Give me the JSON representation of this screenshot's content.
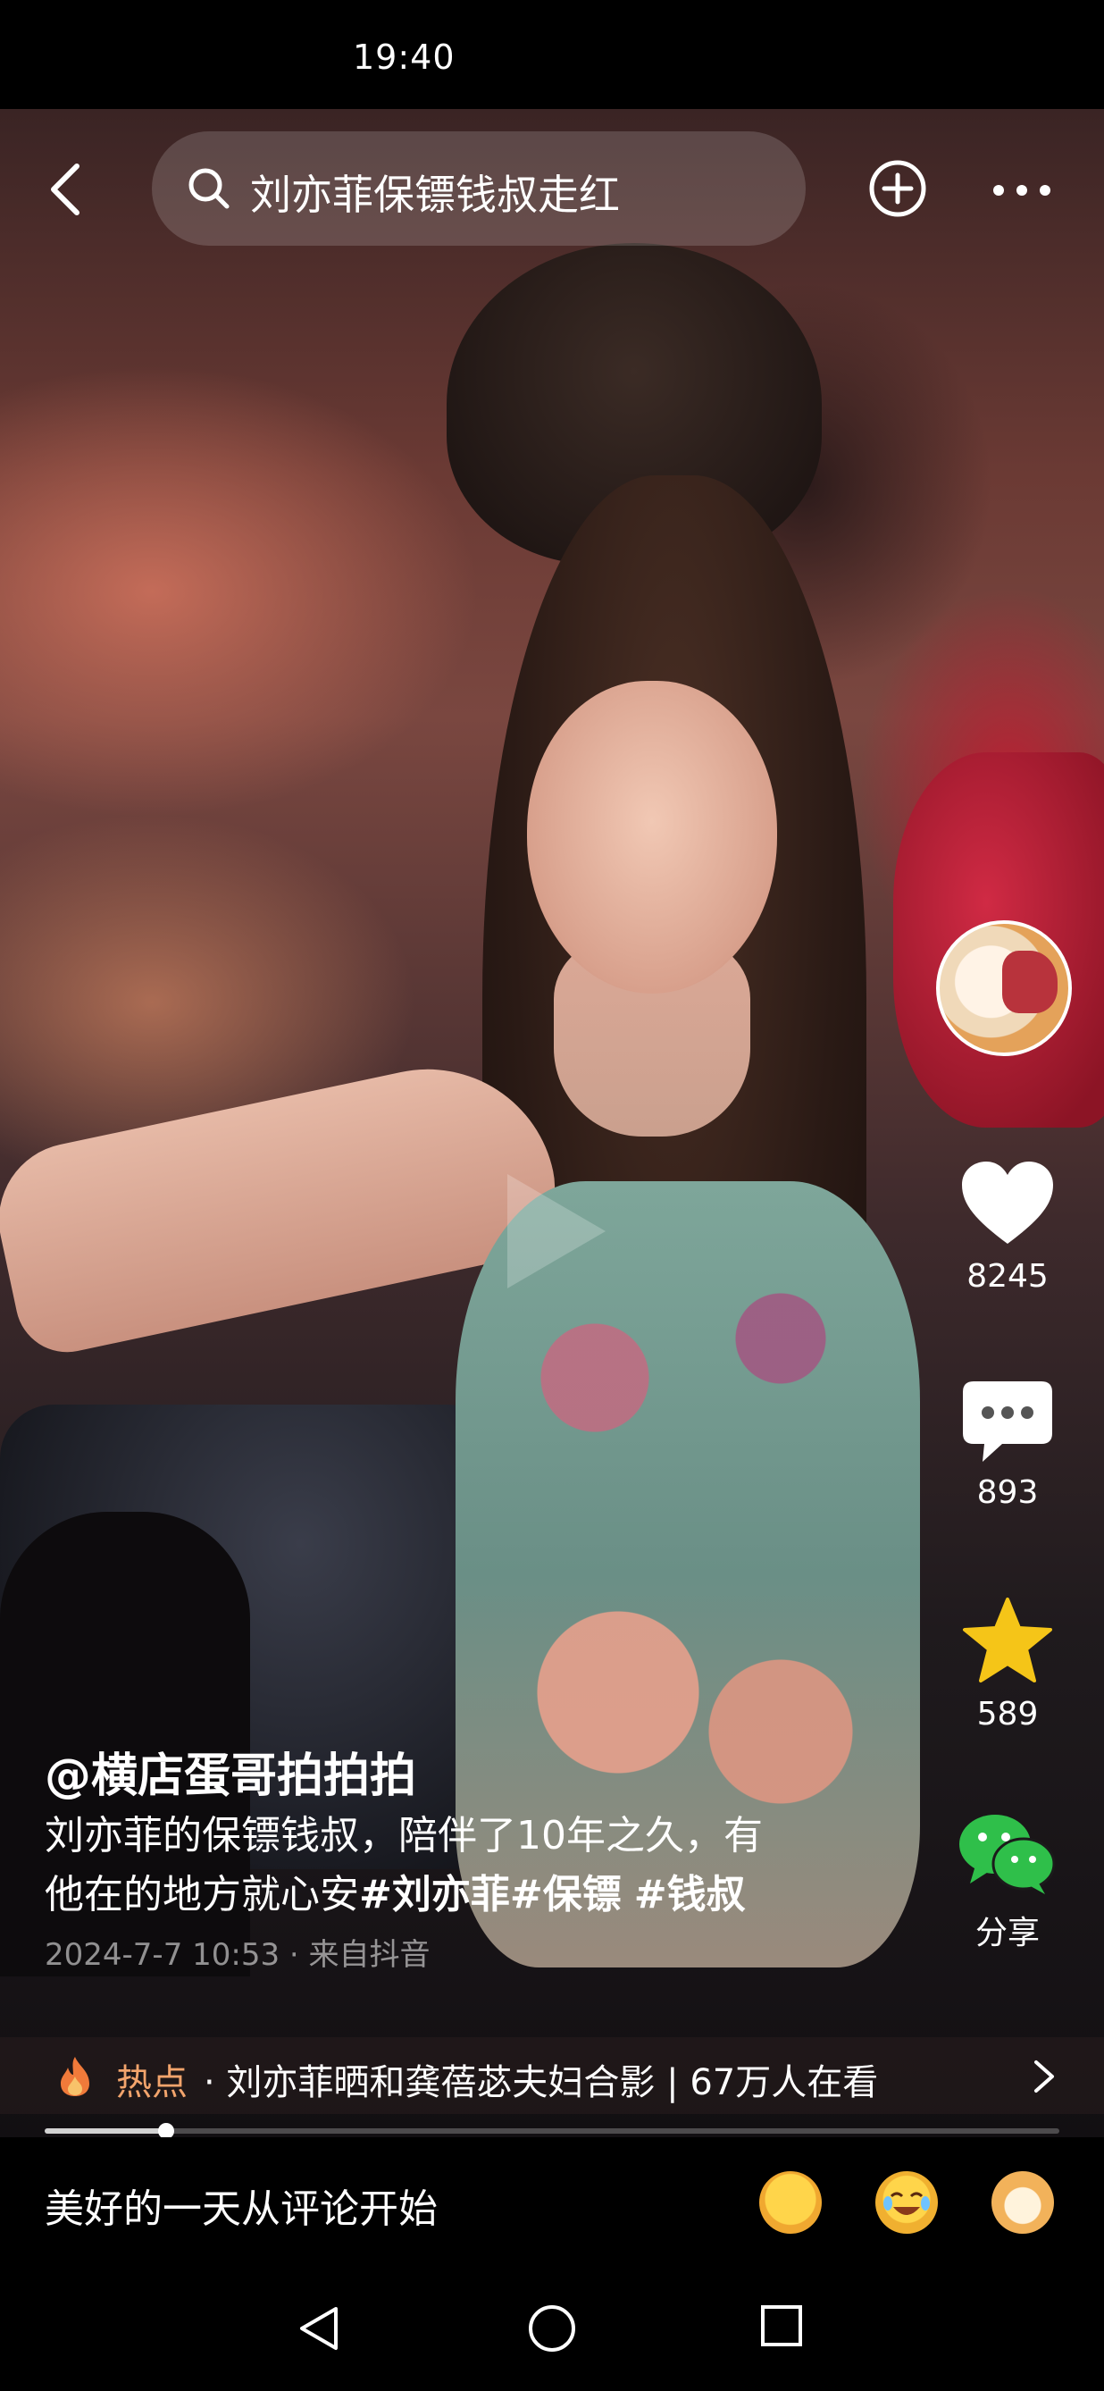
{
  "status_bar": {
    "time": "19:40"
  },
  "top_bar": {
    "search_text": "刘亦菲保镖钱叔走红"
  },
  "rail": {
    "likes": "8245",
    "comments": "893",
    "favorites": "589",
    "share_label": "分享"
  },
  "caption": {
    "author": "@横店蛋哥拍拍拍",
    "text_line1": "刘亦菲的保镖钱叔，陪伴了10年之久，有",
    "text_line2": "他在的地方就心安",
    "tags": [
      "#刘亦菲",
      "#保镖",
      "#钱叔"
    ],
    "meta": "2024-7-7 10:53 · 来自抖音"
  },
  "hot": {
    "label": "热点",
    "title": "· 刘亦菲晒和龚蓓苾夫妇合影 | 67万人在看"
  },
  "playback": {
    "progress_fraction": 0.12
  },
  "comment_bar": {
    "placeholder": "美好的一天从评论开始"
  },
  "colors": {
    "hot_accent": "#f2a46c",
    "like": "#ffffff",
    "star": "#f5c518",
    "wechat": "#2fbf4a"
  },
  "icons": [
    "back-icon",
    "search-icon",
    "add-circle-icon",
    "more-icon",
    "heart-icon",
    "comment-icon",
    "star-icon",
    "wechat-icon",
    "fire-icon",
    "chevron-right-icon",
    "nav-back-icon",
    "nav-home-icon",
    "nav-recents-icon"
  ]
}
